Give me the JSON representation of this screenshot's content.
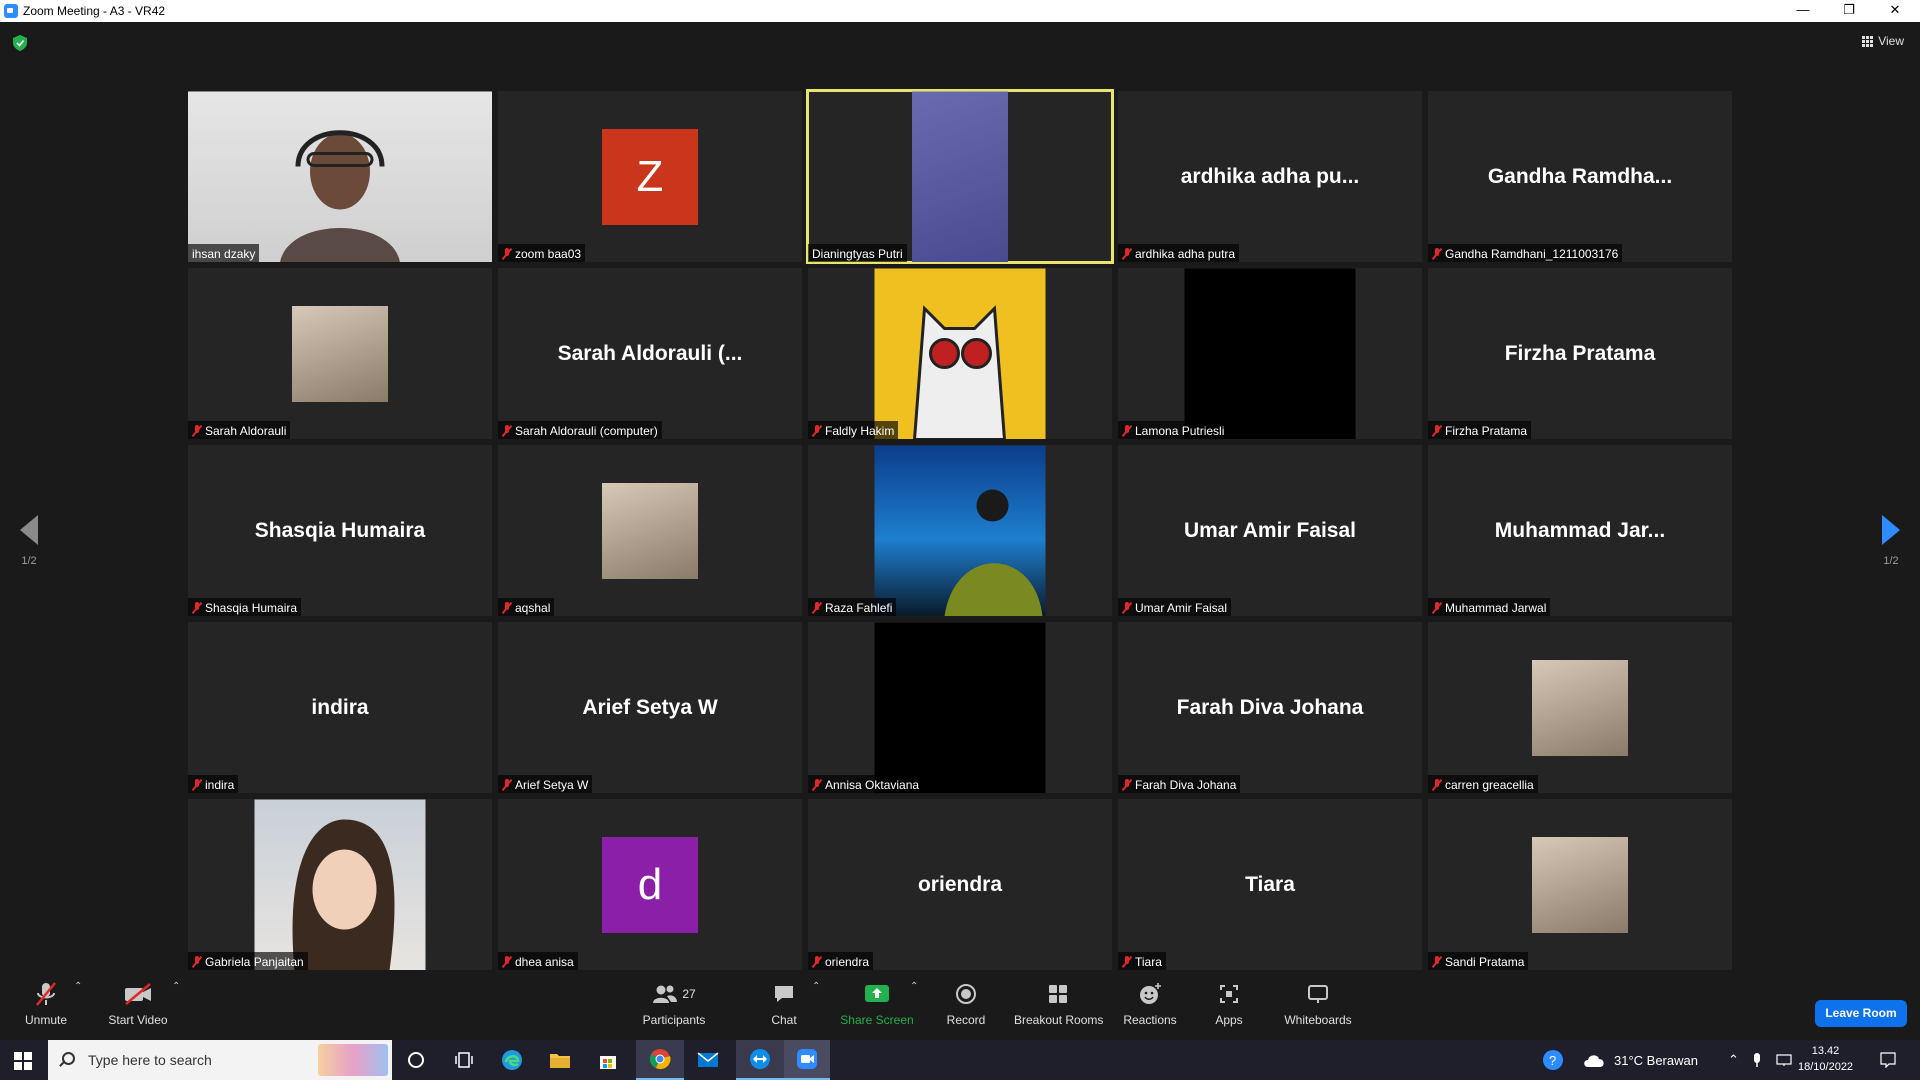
{
  "window": {
    "title": "Zoom Meeting - A3 - VR42",
    "minimize": "—",
    "restore": "❐",
    "close": "✕"
  },
  "meeting": {
    "view_label": "View",
    "page_left": "1/2",
    "page_right": "1/2",
    "tiles": [
      {
        "label": "ihsan dzaky",
        "type": "photo",
        "muted": false
      },
      {
        "label": "zoom baa03",
        "type": "letter",
        "letter": "Z",
        "color": "#c9361b",
        "muted": true
      },
      {
        "label": "Dianingtyas Putri",
        "type": "portrait",
        "muted": false,
        "active": true
      },
      {
        "label": "ardhika adha putra",
        "type": "name",
        "display": "ardhika adha pu...",
        "muted": true
      },
      {
        "label": "Gandha Ramdhani_1211003176",
        "type": "name",
        "display": "Gandha  Ramdha...",
        "muted": true
      },
      {
        "label": "Sarah Aldorauli",
        "type": "smallphoto",
        "muted": true
      },
      {
        "label": "Sarah Aldorauli (computer)",
        "type": "name",
        "display": "Sarah Aldorauli (...",
        "muted": true
      },
      {
        "label": "Faldly Hakim",
        "type": "catvideo",
        "muted": true
      },
      {
        "label": "Lamona Putriesli",
        "type": "black",
        "muted": true
      },
      {
        "label": "Firzha Pratama",
        "type": "name",
        "display": "Firzha Pratama",
        "muted": true
      },
      {
        "label": "Shasqia Humaira",
        "type": "name",
        "display": "Shasqia Humaira",
        "muted": true
      },
      {
        "label": "aqshal",
        "type": "smallphoto",
        "muted": true
      },
      {
        "label": "Raza Fahlefi",
        "type": "poolvideo",
        "muted": true
      },
      {
        "label": "Umar Amir Faisal",
        "type": "name",
        "display": "Umar Amir Faisal",
        "muted": true
      },
      {
        "label": "Muhammad Jarwal",
        "type": "name",
        "display": "Muhammad  Jar...",
        "muted": true
      },
      {
        "label": "indira",
        "type": "name",
        "display": "indira",
        "muted": true
      },
      {
        "label": "Arief Setya W",
        "type": "name",
        "display": "Arief Setya W",
        "muted": true
      },
      {
        "label": "Annisa Oktaviana",
        "type": "black",
        "muted": true
      },
      {
        "label": "Farah Diva Johana",
        "type": "name",
        "display": "Farah Diva Johana",
        "muted": true
      },
      {
        "label": "carren greacellia",
        "type": "smallphoto",
        "muted": true
      },
      {
        "label": "Gabriela Panjaitan",
        "type": "girlvideo",
        "muted": true
      },
      {
        "label": "dhea anisa",
        "type": "letter",
        "letter": "d",
        "color": "#8b1fa8",
        "muted": true
      },
      {
        "label": "oriendra",
        "type": "name",
        "display": "oriendra",
        "muted": true
      },
      {
        "label": "Tiara",
        "type": "name",
        "display": "Tiara",
        "muted": true
      },
      {
        "label": "Sandi Pratama",
        "type": "smallphoto",
        "muted": true
      }
    ]
  },
  "toolbar": {
    "unmute": "Unmute",
    "start_video": "Start Video",
    "participants": "Participants",
    "participants_count": "27",
    "chat": "Chat",
    "share_screen": "Share Screen",
    "record": "Record",
    "breakout_rooms": "Breakout Rooms",
    "reactions": "Reactions",
    "apps": "Apps",
    "whiteboards": "Whiteboards",
    "leave": "Leave Room",
    "colors": {
      "share_green": "#22b14c",
      "leave_blue": "#0e72ed"
    }
  },
  "taskbar": {
    "search_placeholder": "Type here to search",
    "weather": "31°C  Berawan",
    "time": "13.42",
    "date": "18/10/2022"
  }
}
